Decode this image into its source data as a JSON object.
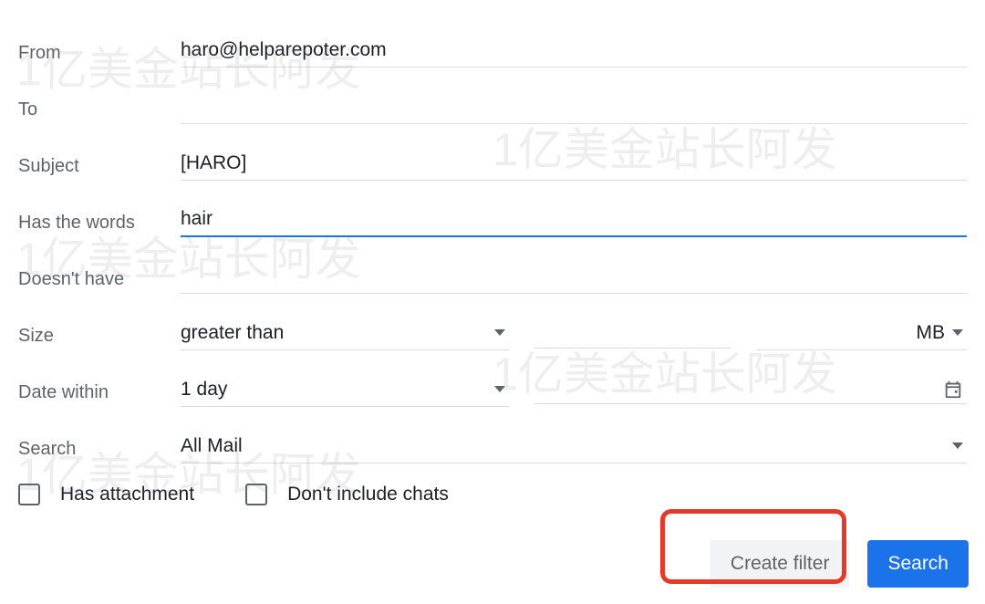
{
  "labels": {
    "from": "From",
    "to": "To",
    "subject": "Subject",
    "has_words": "Has the words",
    "doesnt_have": "Doesn't have",
    "size": "Size",
    "date_within": "Date within",
    "search": "Search"
  },
  "values": {
    "from": "haro@helparepoter.com",
    "to": "",
    "subject": "[HARO]",
    "has_words": "hair",
    "doesnt_have": "",
    "size_operator": "greater than",
    "size_unit": "MB",
    "date_within": "1 day",
    "search_scope": "All Mail"
  },
  "checkboxes": {
    "has_attachment": "Has attachment",
    "dont_include_chats": "Don't include chats"
  },
  "buttons": {
    "create_filter": "Create filter",
    "search": "Search"
  },
  "watermark_text": "1亿美金站长阿发"
}
